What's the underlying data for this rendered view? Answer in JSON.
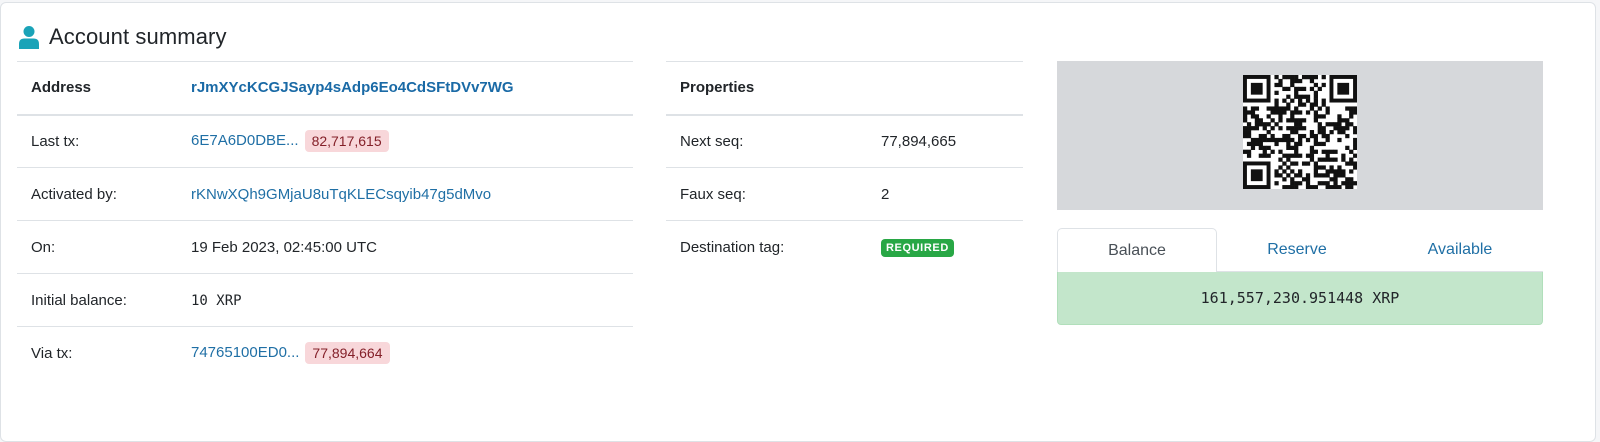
{
  "header": {
    "title": "Account summary",
    "icon": "user-icon"
  },
  "account_table": {
    "rows": [
      {
        "label": "Address",
        "value": "rJmXYcKCGJSayp4sAdp6Eo4CdSFtDVv7WG"
      },
      {
        "label": "Last tx:",
        "value": "6E7A6D0DBE...",
        "badge": "82,717,615"
      },
      {
        "label": "Activated by:",
        "value": "rKNwXQh9GMjaU8uTqKLECsqyib47g5dMvo"
      },
      {
        "label": "On:",
        "value": "19 Feb 2023, 02:45:00 UTC"
      },
      {
        "label": "Initial balance:",
        "value": "10 XRP"
      },
      {
        "label": "Via tx:",
        "value": "74765100ED0...",
        "badge": "77,894,664"
      }
    ]
  },
  "properties_table": {
    "header": "Properties",
    "rows": [
      {
        "label": "Next seq:",
        "value": "77,894,665"
      },
      {
        "label": "Faux seq:",
        "value": "2"
      },
      {
        "label": "Destination tag:",
        "badge": "REQUIRED"
      }
    ]
  },
  "qr": {
    "icon": "qr-code-icon",
    "background": "#d6d8db"
  },
  "tabs": {
    "items": [
      {
        "label": "Balance",
        "active": true
      },
      {
        "label": "Reserve",
        "active": false
      },
      {
        "label": "Available",
        "active": false
      }
    ],
    "content": "161,557,230.951448 XRP"
  },
  "colors": {
    "link": "#1f6fa5",
    "badge_red_bg": "#f8d7da",
    "badge_green": "#28a745",
    "balance_bg": "#c3e6cb",
    "icon_teal": "#1aa3b8"
  }
}
